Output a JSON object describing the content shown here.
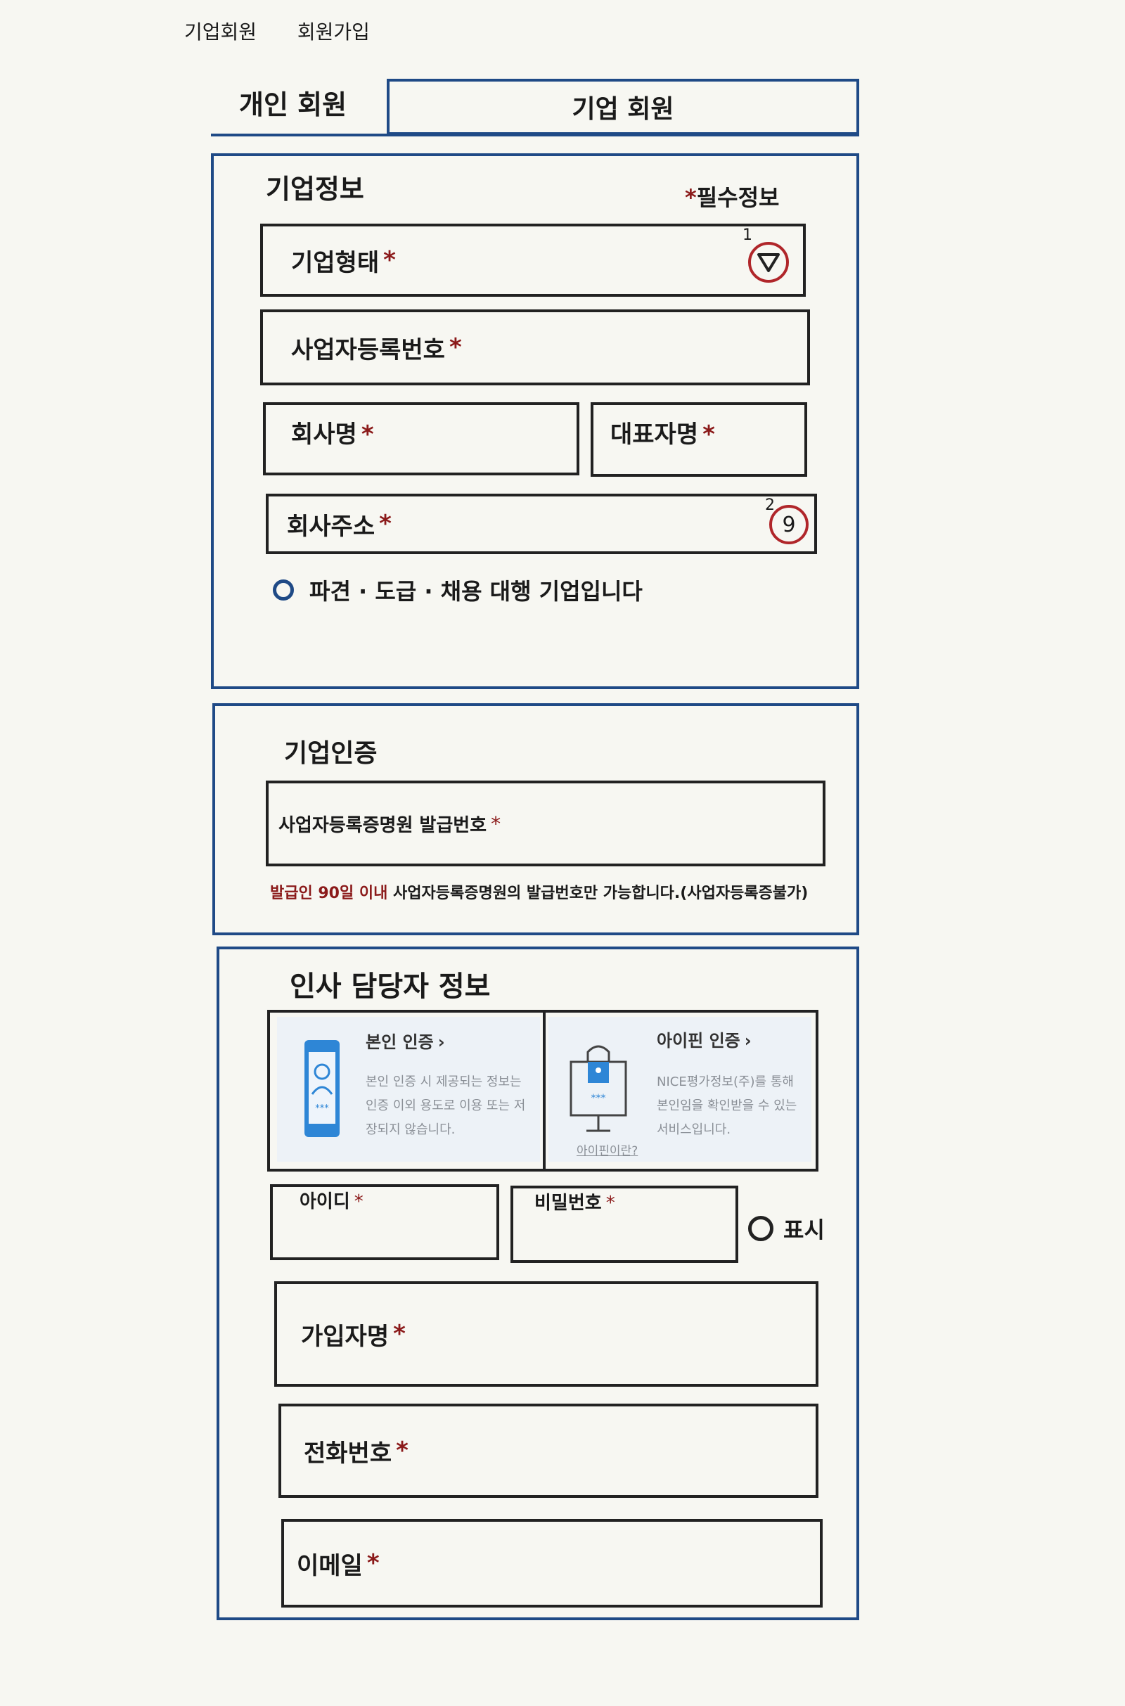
{
  "breadcrumb": {
    "part1": "기업회원",
    "part2": "회원가입"
  },
  "tabs": {
    "personal": "개인 회원",
    "corporate": "기업 회원"
  },
  "company_info": {
    "title": "기업정보",
    "required_note": "필수정보",
    "required_mark": "*",
    "fields": {
      "company_type": "기업형태",
      "business_reg_no": "사업자등록번호",
      "company_name": "회사명",
      "ceo_name": "대표자명",
      "company_address": "회사주소"
    },
    "annotation_1": "1",
    "annotation_2": "2",
    "address_icon_text": "9",
    "dispatch_option": "파견 · 도급 · 채용 대행 기업입니다"
  },
  "company_auth": {
    "title": "기업인증",
    "field": "사업자등록증명원 발급번호",
    "note_red": "발급인 90일 이내",
    "note_rest": "사업자등록증명원의 발급번호만 가능합니다.(사업자등록증불가)"
  },
  "hr_info": {
    "title": "인사 담당자 정보",
    "identity_card": {
      "title": "본인 인증",
      "desc": "본인 인증 시 제공되는 정보는 인증 이외 용도로 이용 또는 저장되지 않습니다.",
      "stars": "***"
    },
    "ipin_card": {
      "title": "아이핀 인증",
      "desc": "NICE평가정보(주)를 통해 본인임을 확인받을 수 있는 서비스입니다.",
      "link": "아이핀이란?",
      "stars": "***"
    },
    "fields": {
      "user_id": "아이디",
      "password": "비밀번호",
      "show": "표시",
      "name": "가입자명",
      "phone": "전화번호",
      "email": "이메일"
    }
  },
  "colors": {
    "accent": "#1f4a86",
    "required": "#8b1a1a",
    "annotation": "#b0262a"
  }
}
